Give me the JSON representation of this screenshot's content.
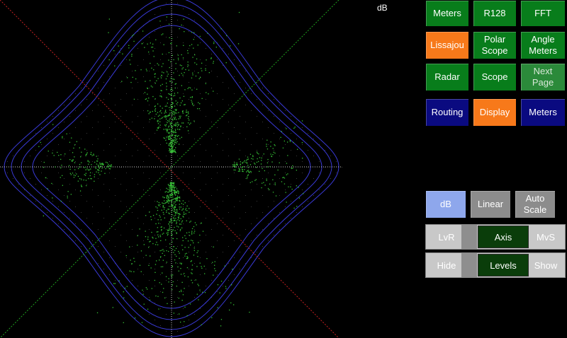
{
  "scale_label": "dB",
  "nav": [
    {
      "key": "meters",
      "label": "Meters",
      "color": "green"
    },
    {
      "key": "r128",
      "label": "R128",
      "color": "green"
    },
    {
      "key": "fft",
      "label": "FFT",
      "color": "green"
    },
    {
      "key": "lissajou",
      "label": "Lissajou",
      "color": "orange"
    },
    {
      "key": "polar-scope",
      "label": "Polar\nScope",
      "color": "green"
    },
    {
      "key": "angle-meters",
      "label": "Angle\nMeters",
      "color": "green"
    },
    {
      "key": "radar",
      "label": "Radar",
      "color": "green"
    },
    {
      "key": "scope",
      "label": "Scope",
      "color": "green"
    },
    {
      "key": "next-page",
      "label": "Next\nPage",
      "color": "green-dim"
    }
  ],
  "modes": [
    {
      "key": "routing",
      "label": "Routing",
      "color": "blue"
    },
    {
      "key": "display",
      "label": "Display",
      "color": "orange"
    },
    {
      "key": "meters-settings",
      "label": "Meters",
      "color": "blue"
    }
  ],
  "scale_buttons": [
    {
      "key": "db",
      "label": "dB",
      "color": "lightblue"
    },
    {
      "key": "linear",
      "label": "Linear",
      "color": "grey"
    },
    {
      "key": "auto-scale",
      "label": "Auto\nScale",
      "color": "grey"
    }
  ],
  "axis_toggle": {
    "left": "LvR",
    "center": "Axis",
    "right": "MvS"
  },
  "levels_toggle": {
    "left": "Hide",
    "center": "Levels",
    "right": "Show"
  },
  "colors": {
    "trace": "#35c035",
    "envelope": "#3a3ad8",
    "diag_red": "#c02020",
    "diag_green": "#20a020",
    "axis": "#cfcfcf"
  }
}
